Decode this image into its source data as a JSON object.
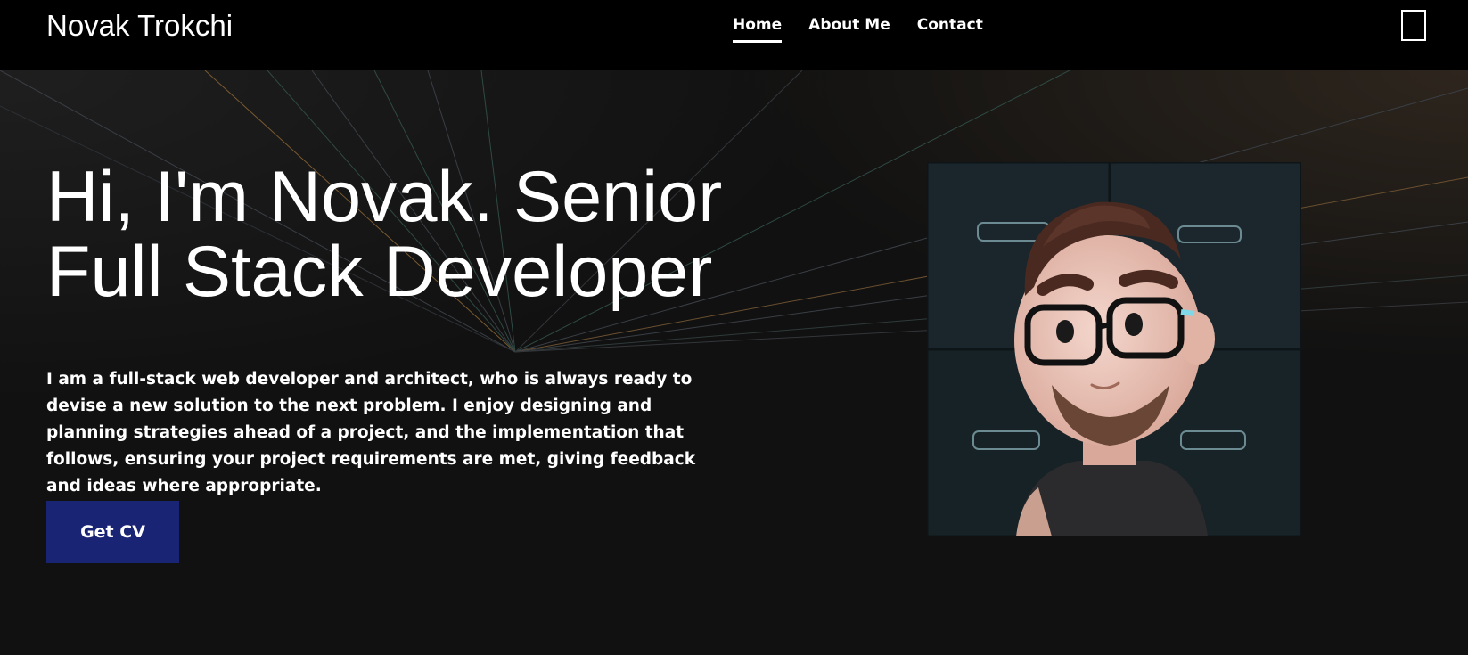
{
  "header": {
    "brand": "Novak Trokchi",
    "nav": [
      {
        "label": "Home",
        "active": true
      },
      {
        "label": "About Me",
        "active": false
      },
      {
        "label": "Contact",
        "active": false
      }
    ],
    "menu_icon": "menu-toggle-icon"
  },
  "hero": {
    "headline": "Hi, I'm Novak. Senior Full Stack Developer",
    "bio": "I am a full-stack web developer and architect, who is always ready to devise a new solution to the next problem. I enjoy designing and planning strategies ahead of a project, and the implementation that follows, ensuring your project requirements are met, giving feedback and ideas where appropriate.",
    "cta_label": "Get CV"
  },
  "colors": {
    "header_bg": "#000000",
    "page_bg": "#111111",
    "button_bg": "#1a2475",
    "text": "#ffffff"
  }
}
